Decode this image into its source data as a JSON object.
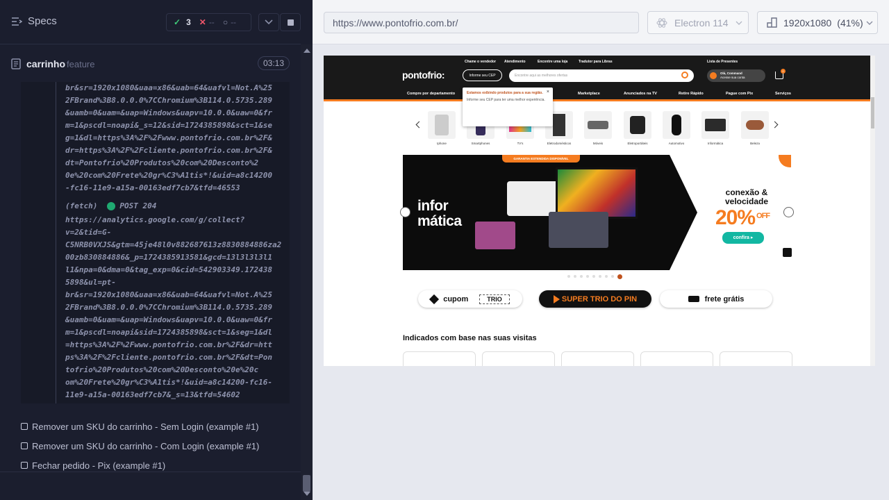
{
  "reporter": {
    "title": "Specs",
    "stats": {
      "passed": "3",
      "failed": "--",
      "pending": "--"
    },
    "spec": {
      "name": "carrinho",
      "ext": "feature",
      "duration": "03:13"
    },
    "log_lines_top": "br&sr=1920x1080&uaa=x86&uab=64&uafvl=Not.A%25\n2FBrand%3B8.0.0.0%7CChromium%3B114.0.5735.289\n&uamb=0&uam=&uap=Windows&uapv=10.0.0&uaw=0&fr\nm=1&pscdl=noapi&_s=12&sid=1724385898&sct=1&se\ng=1&dl=https%3A%2F%2Fwww.pontofrio.com.br%2F&\ndr=https%3A%2F%2Fcliente.pontofrio.com.br%2F&\ndt=Pontofrio%20Produtos%20com%20Desconto%2\n0e%20com%20Frete%20gr%C3%A1tis*!&uid=a8c14200\n-fc16-11e9-a15a-00163edf7cb7&tfd=46553",
    "fetch_label": "(fetch)",
    "fetch_method": "POST 204",
    "log_lines_bottom": "https://analytics.google.com/g/collect?\nv=2&tid=G-\nC5NRB0VXJS&gtm=45je48l0v882687613z8830884886za2\n00zb830884886&_p=1724385913581&gcd=13l3l3l3l1\nl1&npa=0&dma=0&tag_exp=0&cid=542903349.172438\n5898&ul=pt-\nbr&sr=1920x1080&uaa=x86&uab=64&uafvl=Not.A%25\n2FBrand%3B8.0.0.0%7CChromium%3B114.0.5735.289\n&uamb=0&uam=&uap=Windows&uapv=10.0.0&uaw=0&fr\nm=1&pscdl=noapi&sid=1724385898&sct=1&seg=1&dl\n=https%3A%2F%2Fwww.pontofrio.com.br%2F&dr=htt\nps%3A%2F%2Fcliente.pontofrio.com.br%2F&dt=Pon\ntofrio%20Produtos%20com%20Desconto%20e%20c\nom%20Frete%20gr%C3%A1tis*!&uid=a8c14200-fc16-\n11e9-a15a-00163edf7cb7&_s=13&tfd=54602",
    "tests": [
      {
        "label": "Remover um SKU do carrinho - Sem Login (example #1)"
      },
      {
        "label": "Remover um SKU do carrinho - Com Login (example #1)"
      },
      {
        "label": "Fechar pedido - Pix (example #1)"
      }
    ]
  },
  "runner": {
    "url": "https://www.pontofrio.com.br/",
    "browser": "Electron 114",
    "viewport": "1920x1080",
    "scale": "(41%)"
  },
  "site": {
    "top_links": [
      "Chame o vendedor",
      "Atendimento",
      "Encontre uma loja",
      "Tradutor para Libras",
      "Lista de Presentes"
    ],
    "logo": "pontofrio:",
    "cep_button": "Informe seu CEP",
    "search_placeholder": "Encontre aqui as melhores ofertas",
    "login_line1": "Olá, Command",
    "login_line2": "Acesse sua conta",
    "cart_count": "0",
    "nav": [
      "Compre por departamento",
      "Marketplace",
      "Anunciados na TV",
      "Retire Rápido",
      "Pague com Pix",
      "Serviços"
    ],
    "popup_title": "Estamos exibindo produtos para a sua região.",
    "popup_desc": "Informe seu CEP para ter uma melhor experiência.",
    "categories": [
      "Iphone",
      "Smartphones",
      "TV's",
      "Eletrodomésticos",
      "Móveis",
      "Eletroportáteis",
      "Automotivo",
      "Informática",
      "Beleza"
    ],
    "banner": {
      "badge": "GARANTIA ESTENDIDA DISPONÍVEL",
      "headline": "infor\nmática",
      "promo": "conexão & velocidade",
      "discount": "20%",
      "off": "OFF",
      "cta": "confira ▸"
    },
    "pills": {
      "cupom": "cupom",
      "cupom_code": "TRIO",
      "super": "SUPER TRIO DO PIN",
      "frete": "frete grátis"
    },
    "section_title": "Indicados com base nas suas visitas"
  }
}
